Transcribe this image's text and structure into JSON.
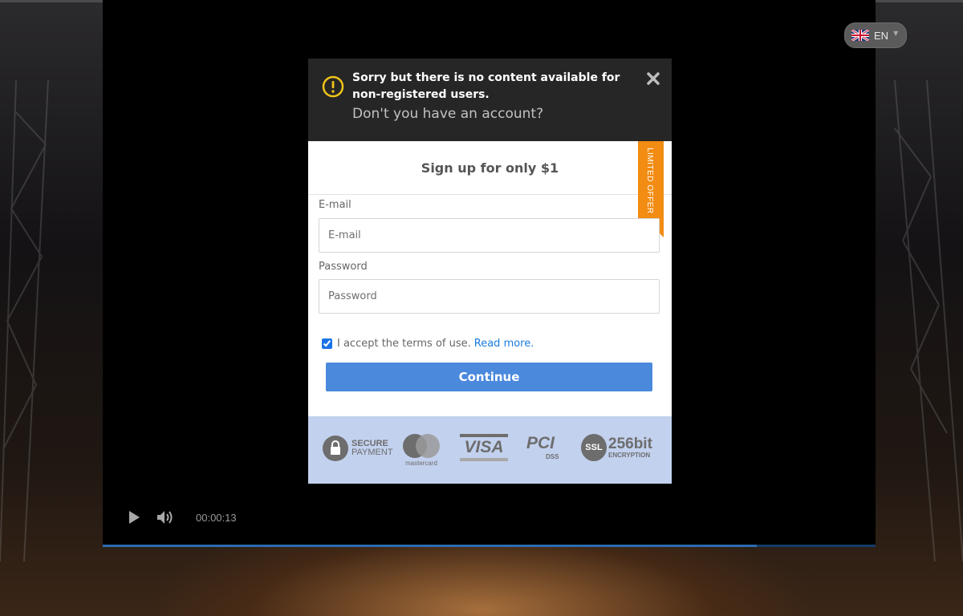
{
  "page": {
    "language_code": "EN"
  },
  "player": {
    "time": "00:00:13",
    "progress_fraction": 0.846
  },
  "alert": {
    "message": "Sorry but there is no content available for non-registered users.",
    "subtext": "Don't you have an account?"
  },
  "form": {
    "heading": "Sign up for only $1",
    "ribbon": "LIMITED OFFER",
    "email": {
      "label": "E-mail",
      "placeholder": "E-mail",
      "value": ""
    },
    "password": {
      "label": "Password",
      "placeholder": "Password",
      "value": ""
    },
    "terms": {
      "text": "I accept the terms of use.",
      "link": "Read more.",
      "checked": true
    },
    "submit_label": "Continue"
  },
  "badges": {
    "secure_payment": {
      "line1": "SECURE",
      "line2": "PAYMENT"
    },
    "mastercard": "mastercard",
    "visa": "VISA",
    "pci": {
      "main": "PCI",
      "sub": "DSS"
    },
    "ssl": {
      "badge": "SSL",
      "bits": "256bit",
      "caption": "ENCRYPTION"
    }
  },
  "colors": {
    "accent_button": "#4a89dc",
    "ribbon": "#f28c12",
    "alert_background": "#262626",
    "badge_strip": "#c2d1ee",
    "link": "#1a7ce0"
  },
  "icons": [
    "warning-circle-icon",
    "close-icon",
    "play-icon",
    "volume-icon",
    "uk-flag-icon",
    "lock-icon"
  ]
}
